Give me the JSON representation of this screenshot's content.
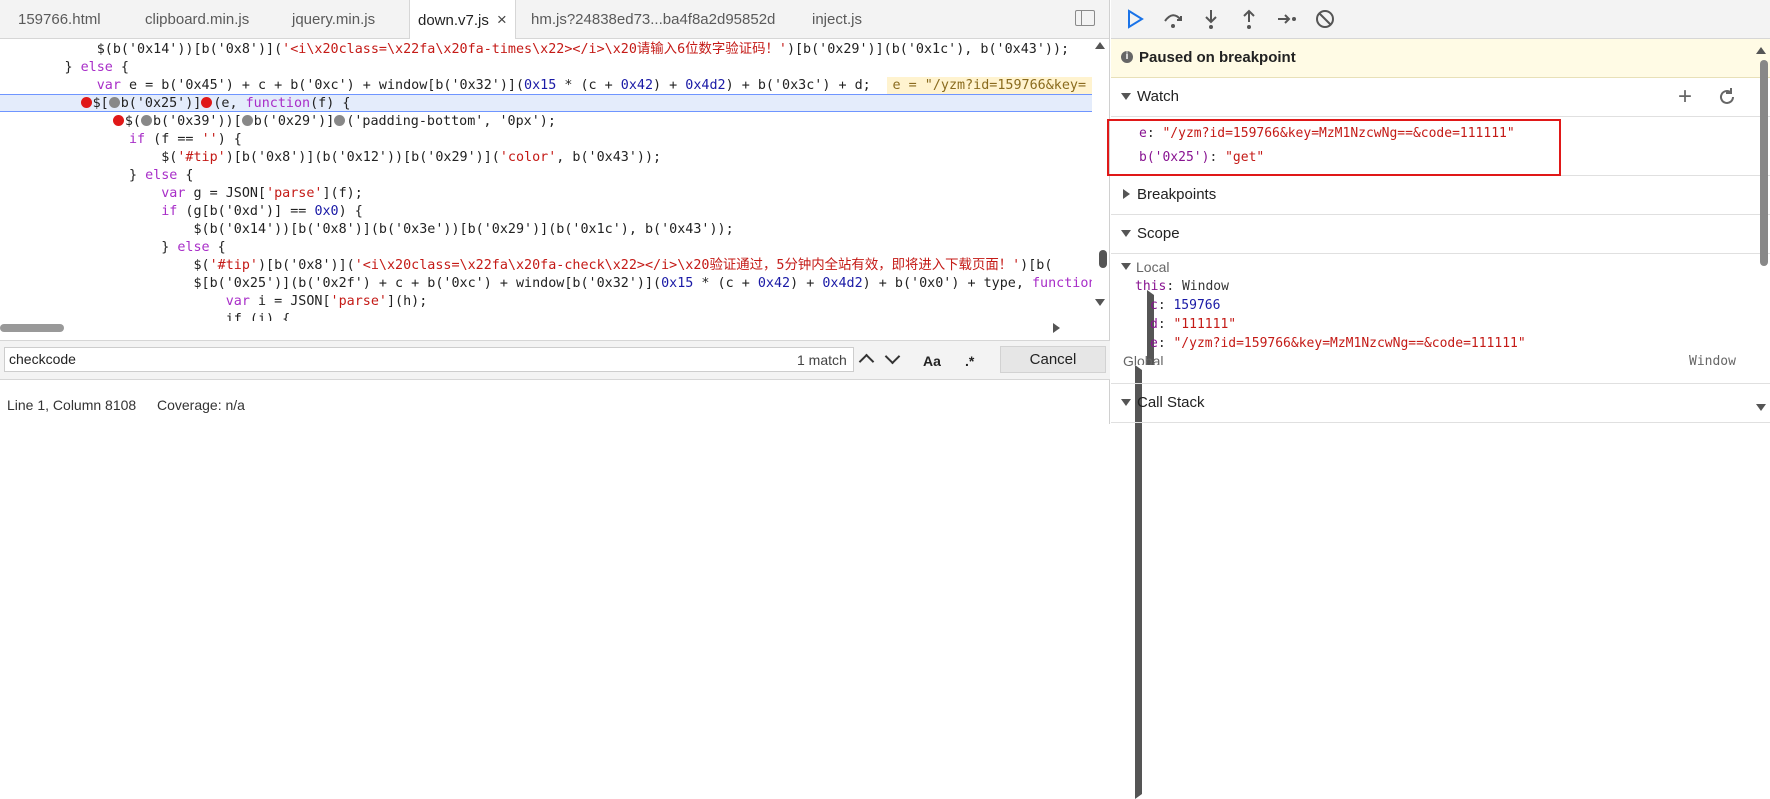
{
  "tabs": [
    {
      "label": "159766.html"
    },
    {
      "label": "clipboard.min.js"
    },
    {
      "label": "jquery.min.js"
    },
    {
      "label": "down.v7.js",
      "close": "×"
    },
    {
      "label": "hm.js?24838ed73...ba4f8a2d95852d"
    },
    {
      "label": "inject.js"
    }
  ],
  "code": {
    "l1a": "            $(b('0x14'))[b('0x8')](",
    "l1b": "'<i\\x20class=\\x22fa\\x20fa-times\\x22></i>\\x20请输入6位数字验证码！'",
    "l1c": ")[b('0x29')](b('0x1c'), b('0x43'));",
    "l2a": "        } ",
    "l2b": "else",
    "l2c": " {",
    "l3a": "            ",
    "l3b": "var",
    "l3c": " e = b('0x45') + c + b('0xc') + window[b('0x32')](",
    "l3d": "0x15",
    "l3e": " * (c + ",
    "l3f": "0x42",
    "l3g": ") + ",
    "l3h": "0x4d2",
    "l3i": ") + b('0x3c') + d;",
    "l3inline": "e = \"/yzm?id=159766&key=",
    "l4a": "$[",
    "l4b": "b('0x25')]",
    "l4c": "(e, ",
    "l4d": "function",
    "l4e": "(f) {",
    "l5a": "$(",
    "l5b": "b('0x39'))[",
    "l5c": "b('0x29')]",
    "l5d": "('padding-bottom', '0px');",
    "l6a": "                ",
    "l6b": "if",
    "l6c": " (f == ",
    "l6d": "''",
    "l6e": ") {",
    "l7a": "                    $(",
    "l7b": "'#tip'",
    "l7c": ")[b('0x8')](b('0x12'))[b('0x29')](",
    "l7d": "'color'",
    "l7e": ", b('0x43'));",
    "l8a": "                } ",
    "l8b": "else",
    "l8c": " {",
    "l9a": "                    ",
    "l9b": "var",
    "l9c": " g = JSON[",
    "l9d": "'parse'",
    "l9e": "](f);",
    "l10a": "                    ",
    "l10b": "if",
    "l10c": " (g[b('0xd')] == ",
    "l10d": "0x0",
    "l10e": ") {",
    "l11": "                        $(b('0x14'))[b('0x8')](b('0x3e'))[b('0x29')](b('0x1c'), b('0x43'));",
    "l12a": "                    } ",
    "l12b": "else",
    "l12c": " {",
    "l13a": "                        $(",
    "l13b": "'#tip'",
    "l13c": ")[b('0x8')](",
    "l13d": "'<i\\x20class=\\x22fa\\x20fa-check\\x22></i>\\x20验证通过，5分钟内全站有效，即将进入下载页面！'",
    "l13e": ")[b(",
    "l14a": "                        $[b('0x25')](b('0x2f') + c + b('0xc') + window[b('0x32')](",
    "l14b": "0x15",
    "l14c": " * (c + ",
    "l14d": "0x42",
    "l14e": ") + ",
    "l14f": "0x4d2",
    "l14g": ") + b('0x0') + type, ",
    "l14h": "function",
    "l15a": "                            ",
    "l15b": "var",
    "l15c": " i = JSON[",
    "l15d": "'parse'",
    "l15e": "](h);",
    "l16": "                            if (i) {"
  },
  "search": {
    "value": "checkcode",
    "match_count": "1 match",
    "case_label": "Aa",
    "regex_label": ".*",
    "cancel_label": "Cancel"
  },
  "status": {
    "position": "Line 1, Column 8108",
    "coverage": "Coverage: n/a"
  },
  "debugger": {
    "paused_label": "Paused on breakpoint",
    "watch_title": "Watch",
    "watch_items": [
      {
        "name": "e",
        "value": "\"/yzm?id=159766&key=MzM1NzcwNg==&code=111111\""
      },
      {
        "name": "b('0x25')",
        "value": "\"get\""
      }
    ],
    "breakpoints_title": "Breakpoints",
    "scope_title": "Scope",
    "local_label": "Local",
    "this_name": "this",
    "this_value": "Window",
    "scope_items": [
      {
        "name": "c",
        "value": "159766"
      },
      {
        "name": "d",
        "value": "\"111111\""
      },
      {
        "name": "e",
        "value": "\"/yzm?id=159766&key=MzM1NzcwNg==&code=111111\""
      }
    ],
    "global_label": "Global",
    "global_value": "Window",
    "callstack_title": "Call Stack"
  }
}
